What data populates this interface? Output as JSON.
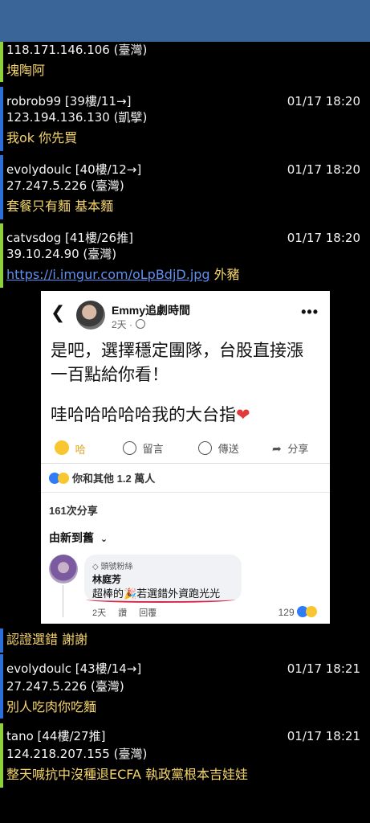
{
  "posts": [
    {
      "lines": [
        "118.171.146.106 (臺灣)"
      ],
      "content": "塊陶阿"
    },
    {
      "author": "robrob99 [39樓/11→]",
      "time": "01/17 18:20",
      "ip": "123.194.136.130 (凱擘)",
      "content": "我ok 你先買"
    },
    {
      "author": "evolydoulc [40樓/12→]",
      "time": "01/17 18:20",
      "ip": "27.247.5.226 (臺灣)",
      "content": "套餐只有麵 基本麵"
    },
    {
      "author": "catvsdog [41樓/26推]",
      "time": "01/17 18:20",
      "ip": "39.10.24.90 (臺灣)",
      "link": "https://i.imgur.com/oLpBdjD.jpg",
      "content": "外豬"
    },
    {
      "content": "認證選錯 謝謝"
    },
    {
      "author": "evolydoulc [43樓/14→]",
      "time": "01/17 18:21",
      "ip": "27.247.5.226 (臺灣)",
      "content": "別人吃肉你吃麵"
    },
    {
      "author": "tano [44樓/27推]",
      "time": "01/17 18:21",
      "ip": "124.218.207.155 (臺灣)",
      "content": "整天喊抗中沒種退ECFA  執政黨根本吉娃娃"
    }
  ],
  "embed": {
    "page_name": "Emmy追劇時間",
    "post_time": "2天 ·",
    "text_line1": "是吧，選擇穩定團隊，台股直接漲",
    "text_line2": "一百點給你看！",
    "text_line3": "哇哈哈哈哈哈我的大台指",
    "actions": {
      "haha": "哈",
      "comment": "留言",
      "send": "傳送",
      "share": "分享"
    },
    "reactions_text": "你和其他 1.2 萬人",
    "shares_text": "161次分享",
    "sort_label": "由新到舊",
    "comment": {
      "badge": "頭號粉絲",
      "name": "林庭芳",
      "text": "超棒的🎉若選錯外資跑光光",
      "footer": "2天 讚 回覆",
      "count": "129"
    }
  }
}
